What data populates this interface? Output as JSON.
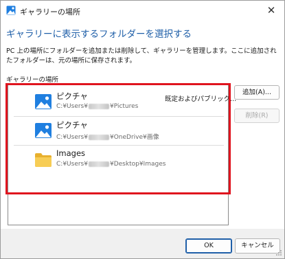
{
  "window": {
    "title": "ギャラリーの場所",
    "close_glyph": "✕"
  },
  "heading": "ギャラリーに表示するフォルダーを選択する",
  "description": "PC 上の場所にフォルダーを追加または削除して、ギャラリーを管理します。ここに追加されたフォルダーは、元の場所に保存されます。",
  "section_label": "ギャラリーの場所",
  "locations": [
    {
      "name": "ピクチャ",
      "path_prefix": "C:¥Users¥",
      "path_suffix": "¥Pictures",
      "badge": "既定およびパブリック...",
      "icon": "pictures-icon"
    },
    {
      "name": "ピクチャ",
      "path_prefix": "C:¥Users¥",
      "path_suffix": "¥OneDrive¥画像",
      "badge": "",
      "icon": "pictures-icon"
    },
    {
      "name": "Images",
      "path_prefix": "C:¥Users¥",
      "path_suffix": "¥Desktop¥Images",
      "badge": "",
      "icon": "folder-icon"
    }
  ],
  "buttons": {
    "add": "追加(A)...",
    "remove": "削除(R)",
    "ok": "OK",
    "cancel": "キャンセル"
  },
  "colors": {
    "heading": "#1f5fa8",
    "highlight": "#e0141e",
    "picture_icon": "#1f7fe0",
    "folder_icon": "#f5c542"
  }
}
